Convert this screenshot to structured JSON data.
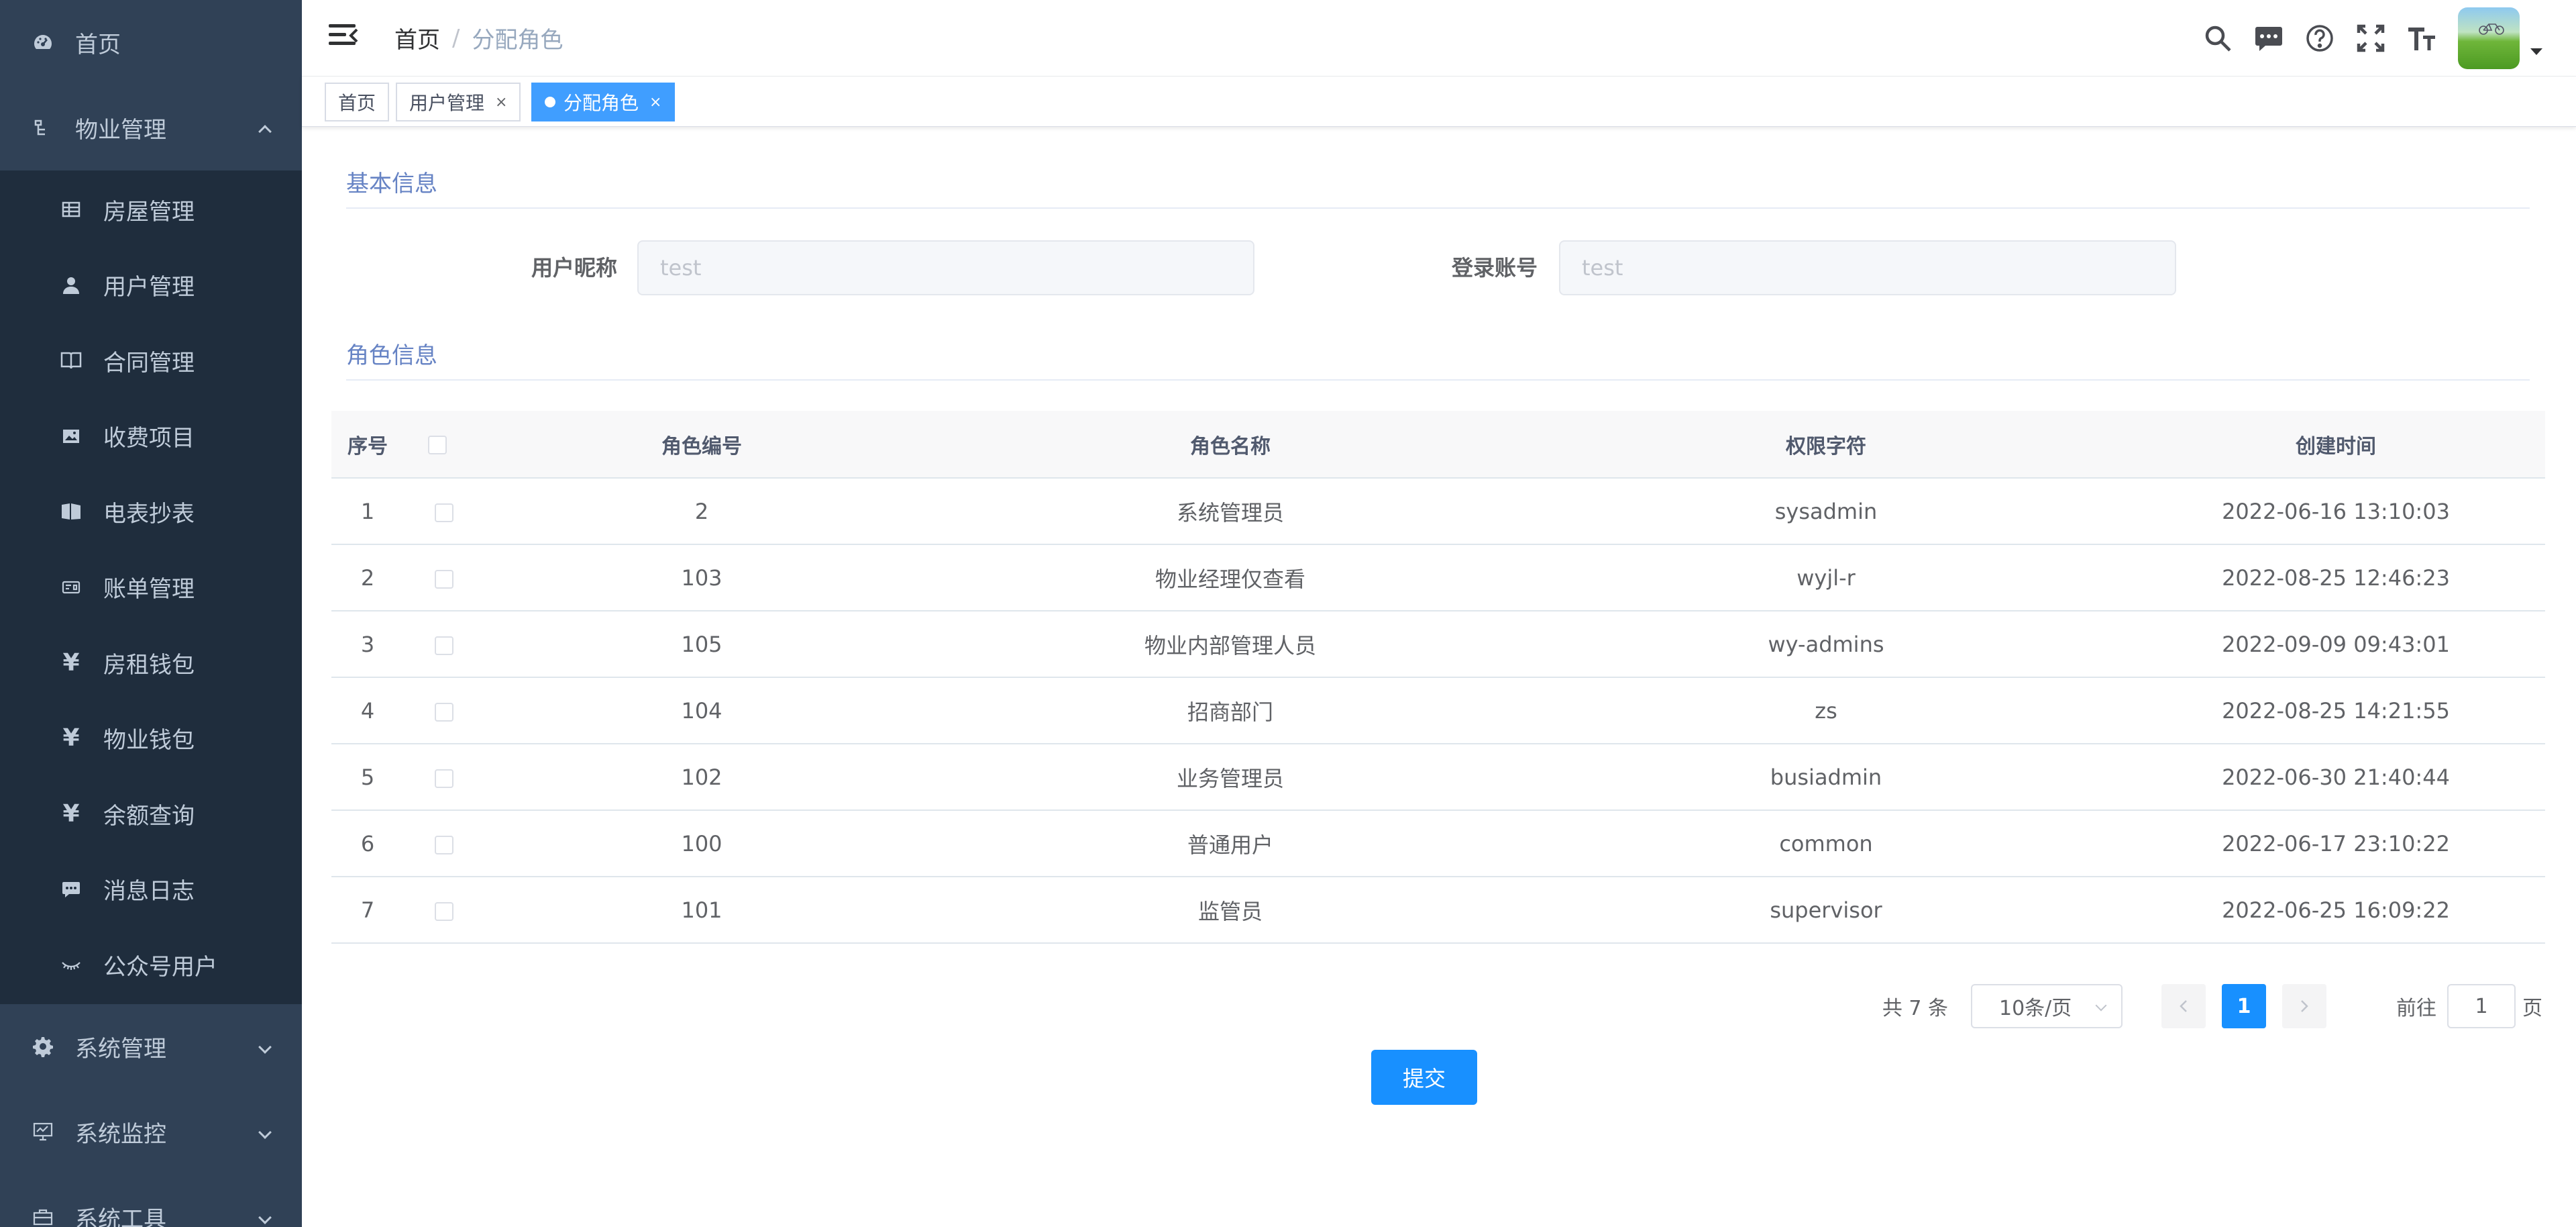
{
  "sidebar": {
    "home": {
      "label": "首页",
      "icon": "dashboard-icon"
    },
    "property": {
      "label": "物业管理",
      "icon": "tree-icon",
      "expanded": true
    },
    "sub_items": [
      {
        "label": "房屋管理",
        "icon": "table-icon"
      },
      {
        "label": "用户管理",
        "icon": "user-icon"
      },
      {
        "label": "合同管理",
        "icon": "book-icon"
      },
      {
        "label": "收费项目",
        "icon": "image-icon"
      },
      {
        "label": "电表抄表",
        "icon": "documentation-icon"
      },
      {
        "label": "账单管理",
        "icon": "money-card-icon"
      },
      {
        "label": "房租钱包",
        "icon": "yen-icon",
        "glyph": "¥"
      },
      {
        "label": "物业钱包",
        "icon": "yen-icon",
        "glyph": "¥"
      },
      {
        "label": "余额查询",
        "icon": "yen-icon",
        "glyph": "¥"
      },
      {
        "label": "消息日志",
        "icon": "message-icon"
      },
      {
        "label": "公众号用户",
        "icon": "eye-closed-icon"
      }
    ],
    "system": {
      "label": "系统管理",
      "icon": "gear-icon"
    },
    "monitor": {
      "label": "系统监控",
      "icon": "monitor-icon"
    },
    "tools": {
      "label": "系统工具",
      "icon": "toolbox-icon"
    }
  },
  "navbar": {
    "breadcrumb_home": "首页",
    "breadcrumb_sep": "/",
    "breadcrumb_current": "分配角色"
  },
  "tags": [
    {
      "label": "首页",
      "active": false
    },
    {
      "label": "用户管理",
      "active": false,
      "close": "×"
    },
    {
      "label": "分配角色",
      "active": true,
      "close": "×"
    }
  ],
  "basic_info": {
    "title": "基本信息",
    "nickname_label": "用户昵称",
    "nickname_value": "test",
    "account_label": "登录账号",
    "account_value": "test"
  },
  "role_info": {
    "title": "角色信息",
    "columns": [
      "序号",
      "角色编号",
      "角色名称",
      "权限字符",
      "创建时间"
    ],
    "rows": [
      {
        "index": "1",
        "id": "2",
        "name": "系统管理员",
        "key": "sysadmin",
        "created": "2022-06-16 13:10:03"
      },
      {
        "index": "2",
        "id": "103",
        "name": "物业经理仅查看",
        "key": "wyjl-r",
        "created": "2022-08-25 12:46:23"
      },
      {
        "index": "3",
        "id": "105",
        "name": "物业内部管理人员",
        "key": "wy-admins",
        "created": "2022-09-09 09:43:01"
      },
      {
        "index": "4",
        "id": "104",
        "name": "招商部门",
        "key": "zs",
        "created": "2022-08-25 14:21:55"
      },
      {
        "index": "5",
        "id": "102",
        "name": "业务管理员",
        "key": "busiadmin",
        "created": "2022-06-30 21:40:44"
      },
      {
        "index": "6",
        "id": "100",
        "name": "普通用户",
        "key": "common",
        "created": "2022-06-17 23:10:22"
      },
      {
        "index": "7",
        "id": "101",
        "name": "监管员",
        "key": "supervisor",
        "created": "2022-06-25 16:09:22"
      }
    ]
  },
  "pagination": {
    "total": "共 7 条",
    "page_size": "10条/页",
    "current_page": "1",
    "goto_prefix": "前往",
    "goto_value": "1",
    "goto_suffix": "页"
  },
  "submit_label": "提交",
  "colors": {
    "sidebar_bg": "#304156",
    "submenu_bg": "#1f2d3d",
    "primary": "#1890ff",
    "tag_active": "#409eff"
  }
}
